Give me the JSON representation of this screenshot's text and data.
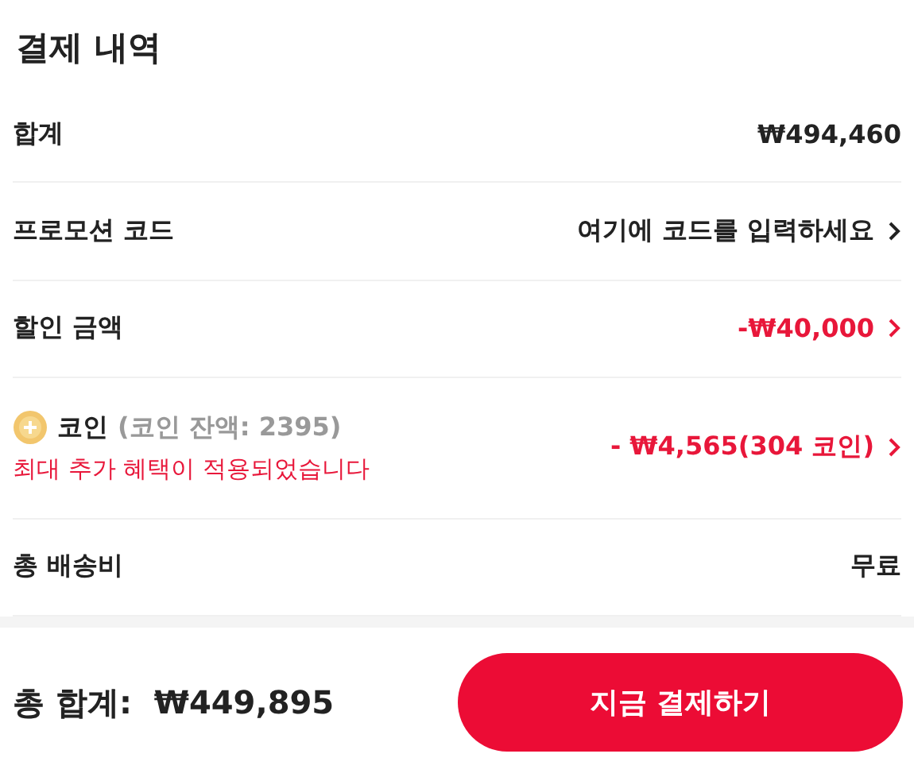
{
  "title": "결제 내역",
  "rows": [
    {
      "kind": "plain",
      "label": "합계",
      "value": "₩494,460",
      "highlight": false,
      "chevron": false
    },
    {
      "kind": "plain",
      "label": "프로모션 코드",
      "value": "여기에 코드를 입력하세요",
      "highlight": false,
      "chevron": true
    },
    {
      "kind": "plain",
      "label": "할인 금액",
      "value": "-₩40,000",
      "highlight": true,
      "chevron": true
    },
    {
      "kind": "coin",
      "label": "코인",
      "balance": "(코인 잔액: 2395)",
      "note": "최대 추가 혜택이 적용되었습니다",
      "value": "- ₩4,565(304 코인)",
      "highlight": true,
      "chevron": true
    },
    {
      "kind": "plain",
      "label": "총 배송비",
      "value": "무료",
      "highlight": false,
      "chevron": false
    }
  ],
  "footer": {
    "total_label": "총 합계:",
    "total_value": "₩449,895",
    "button": "지금 결제하기"
  }
}
